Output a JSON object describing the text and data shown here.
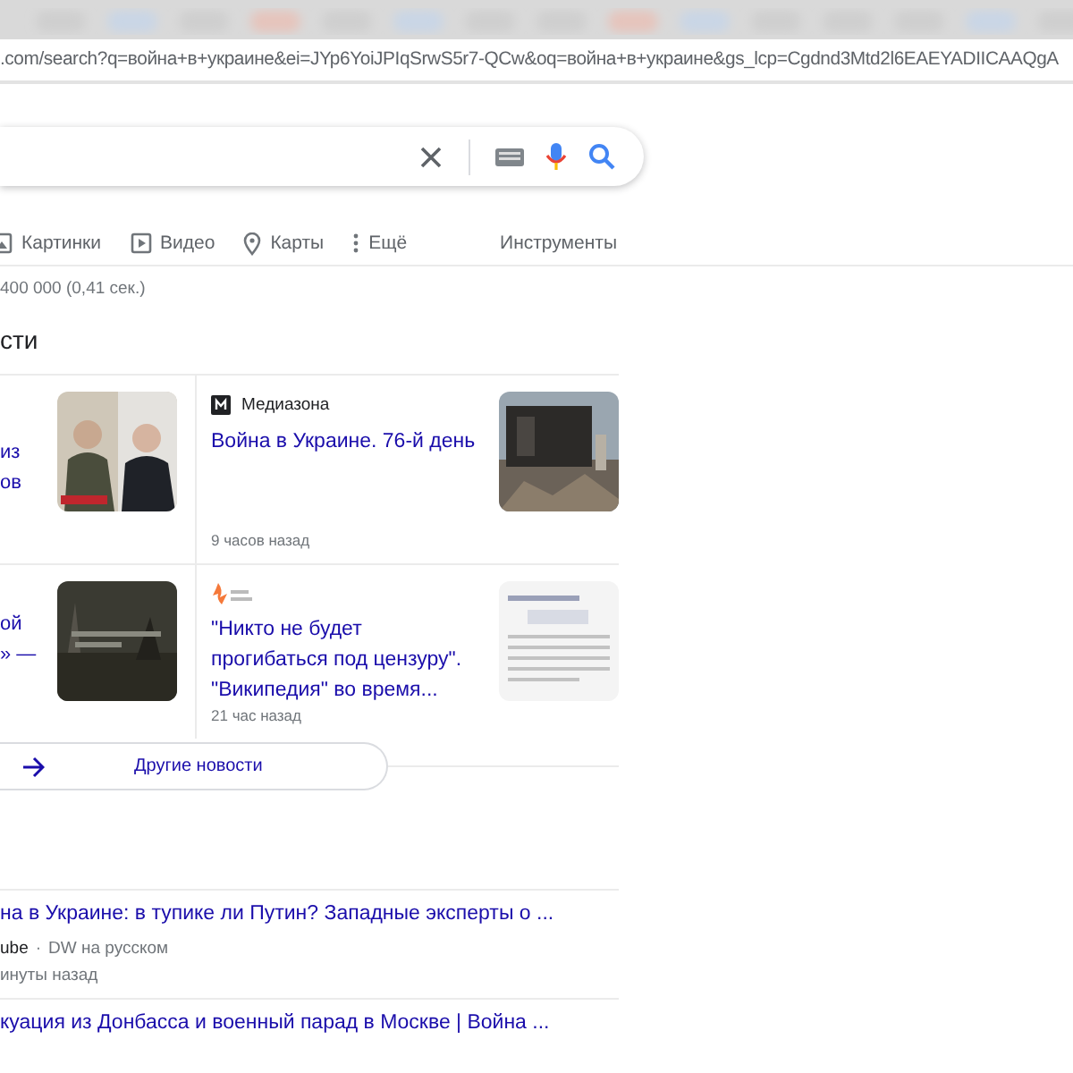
{
  "address_bar": {
    "url": ".com/search?q=война+в+украине&ei=JYp6YoiJPIqSrwS5r7-QCw&oq=война+в+украине&gs_lcp=Cgdnd3Mtd2l6EAEYADIICAAQgA"
  },
  "tabs": [
    {
      "label": "Картинки",
      "selected": false
    },
    {
      "label": "Видео",
      "selected": false
    },
    {
      "label": "Карты",
      "selected": false
    },
    {
      "label": "Ещё",
      "selected": false
    }
  ],
  "tools": "Инструменты",
  "result_stats": "400 000 (0,41 сек.)",
  "news": {
    "heading": "сти",
    "left_cards": [
      {
        "lines": [
          "из",
          "ов"
        ]
      },
      {
        "lines": [
          "ой",
          "» —"
        ]
      }
    ],
    "right_cards": [
      {
        "source": "Медиазона",
        "title": "Война в Украине. 76-й день",
        "time": "9 часов назад"
      },
      {
        "title": "\"Никто не будет прогибаться под цензуру\". \"Википедия\" во время...",
        "time": "21 час назад"
      }
    ],
    "more_button": "Другие новости"
  },
  "results": [
    {
      "title": "на в Украине: в тупике ли Путин? Западные эксперты о ...",
      "site": "ube",
      "separator": "·",
      "channel": "DW на русском",
      "time": "инуты назад"
    },
    {
      "title": "куация из Донбасса и военный парад в Москве | Война ..."
    }
  ]
}
